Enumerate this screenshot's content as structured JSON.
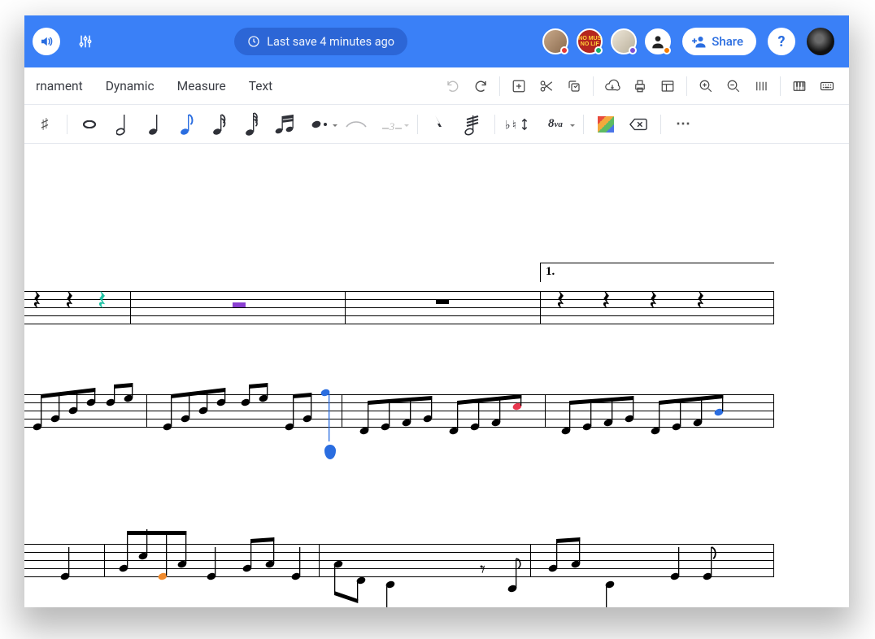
{
  "topbar": {
    "last_save_text": "Last save 4 minutes ago",
    "share_label": "Share",
    "help_label": "?",
    "avatars": [
      {
        "name": "user-1",
        "bg": "#c9a98a",
        "dot": "#e53935"
      },
      {
        "name": "user-2",
        "bg": "#b4261f",
        "dot": "#17b06a"
      },
      {
        "name": "user-3",
        "bg": "#d8d3c6",
        "dot": "#7b4fd6"
      },
      {
        "name": "user-4",
        "bg": "#ffffff",
        "dot": "#f57c00",
        "glyph": "person"
      },
      {
        "name": "user-owner",
        "bg": "#111111",
        "dot": null,
        "rightmost": true
      }
    ]
  },
  "menubar": {
    "items": [
      "rnament",
      "Dynamic",
      "Measure",
      "Text"
    ],
    "tools": [
      "undo",
      "redo",
      "|",
      "add",
      "cut",
      "paste",
      "|",
      "download",
      "print",
      "layout",
      "|",
      "zoom-in",
      "zoom-out",
      "measures",
      "|",
      "piano",
      "keyboard"
    ]
  },
  "notebar": {
    "items": [
      {
        "id": "sharp",
        "glyph": "♯"
      },
      {
        "id": "whole",
        "glyph": "𝅝"
      },
      {
        "id": "half",
        "glyph": "𝅗𝅥"
      },
      {
        "id": "quarter",
        "glyph": "♩"
      },
      {
        "id": "eighth",
        "glyph": "♪",
        "selected": true
      },
      {
        "id": "sixteenth",
        "glyph": "𝅘𝅥𝅯"
      },
      {
        "id": "thirtysecond",
        "glyph": "𝅘𝅥𝅰"
      },
      {
        "id": "sixteenth-pair",
        "glyph": "♬"
      },
      {
        "id": "dot",
        "glyph": "·",
        "dropdown": true
      },
      {
        "id": "tie",
        "glyph": "⌣"
      },
      {
        "id": "tuplet",
        "glyph": "3",
        "dropdown": true
      },
      {
        "id": "|"
      },
      {
        "id": "caesura",
        "glyph": "𝄐"
      },
      {
        "id": "tremolo",
        "glyph": "⊘"
      },
      {
        "id": "|"
      },
      {
        "id": "transpose",
        "glyph": "♭♮↕"
      },
      {
        "id": "octave",
        "glyph": "8va",
        "italic": true,
        "dropdown": true
      },
      {
        "id": "|"
      },
      {
        "id": "color-picker",
        "color": true
      },
      {
        "id": "erase",
        "glyph": "⌫"
      },
      {
        "id": "|"
      },
      {
        "id": "more",
        "glyph": "⋯"
      }
    ]
  },
  "score": {
    "volta_label": "1.",
    "colored_notes": {
      "teal_rest": "#1fc2a4",
      "purple_rest": "#8a3fd1",
      "blue_note": "#2a6de0",
      "red_note": "#e8384f",
      "orange_note": "#f08a2c"
    }
  }
}
